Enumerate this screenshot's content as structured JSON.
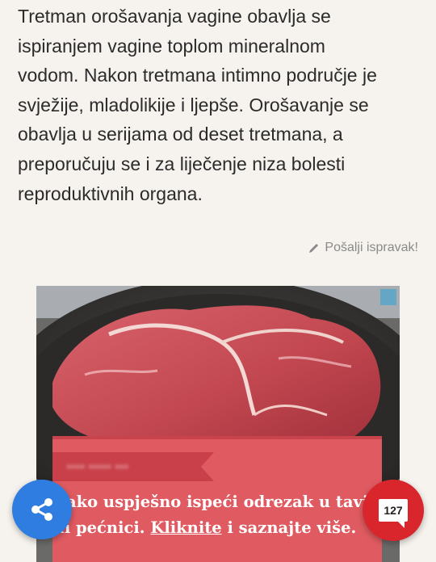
{
  "article": {
    "lines": [
      "Tretman orošavanja vagine obavlja se",
      "ispiranjem vagine toplom mineralnom",
      "vodom. Nakon tretmana intimno područje je",
      "svježije, mladolikije i ljepše. Orošavanje se",
      "obavlja u serijama od deset tretmana, a",
      "preporučuju se i za liječenje niza bolesti",
      "reproduktivnih organa."
    ]
  },
  "report": {
    "label": "Pošalji ispravak!",
    "icon": "pencil-icon"
  },
  "ad": {
    "headline_line1": "Kako uspješno ispeći odrezak u tavi",
    "headline_line2_prefix": "ili pećnici.",
    "cta": "Kliknite",
    "headline_line2_suffix": "i saznajte više.",
    "colors": {
      "banner": "#e05b61",
      "ribbon": "#c9404a"
    }
  },
  "share": {
    "icon": "share-icon",
    "color": "#2f7de0"
  },
  "comments": {
    "count": "127",
    "icon": "comment-icon",
    "color": "#d9262c"
  }
}
